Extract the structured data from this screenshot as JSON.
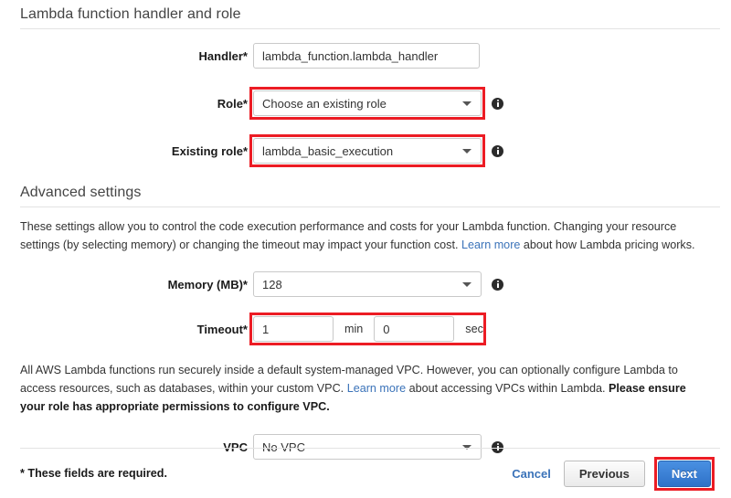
{
  "handler_section": {
    "title": "Lambda function handler and role",
    "fields": {
      "handler": {
        "label": "Handler*",
        "value": "lambda_function.lambda_handler"
      },
      "role": {
        "label": "Role*",
        "value": "Choose an existing role",
        "caret_icon": "chevron-down-icon",
        "info_icon": "info-icon",
        "highlighted": true
      },
      "existing_role": {
        "label": "Existing role*",
        "value": "lambda_basic_execution",
        "caret_icon": "chevron-down-icon",
        "info_icon": "info-icon",
        "highlighted": true
      }
    }
  },
  "advanced_section": {
    "title": "Advanced settings",
    "description_part1": "These settings allow you to control the code execution performance and costs for your Lambda function. Changing your resource settings (by selecting memory) or changing the timeout may impact your function cost. ",
    "description_link": "Learn more",
    "description_part2": " about how Lambda pricing works.",
    "fields": {
      "memory": {
        "label": "Memory (MB)*",
        "value": "128",
        "caret_icon": "chevron-down-icon",
        "info_icon": "info-icon"
      },
      "timeout": {
        "label": "Timeout*",
        "minutes": "1",
        "minutes_unit": "min",
        "seconds": "0",
        "seconds_unit": "sec",
        "highlighted": true
      }
    }
  },
  "vpc_section": {
    "description_part1": "All AWS Lambda functions run securely inside a default system-managed VPC. However, you can optionally configure Lambda to access resources, such as databases, within your custom VPC. ",
    "description_link": "Learn more",
    "description_part2": " about accessing VPCs within Lambda. ",
    "description_bold": "Please ensure your role has appropriate permissions to configure VPC.",
    "fields": {
      "vpc": {
        "label": "VPC",
        "value": "No VPC",
        "caret_icon": "chevron-down-icon",
        "info_icon": "info-icon"
      }
    }
  },
  "footer": {
    "required_note": "* These fields are required.",
    "cancel_label": "Cancel",
    "previous_label": "Previous",
    "next_label": "Next",
    "next_highlighted": true
  },
  "colors": {
    "annotation_red": "#ec1c24",
    "link_blue": "#3b73b9",
    "primary_button": "#2f72c8",
    "border_grey": "#c9c9c9",
    "rule_grey": "#e3e3e3"
  }
}
